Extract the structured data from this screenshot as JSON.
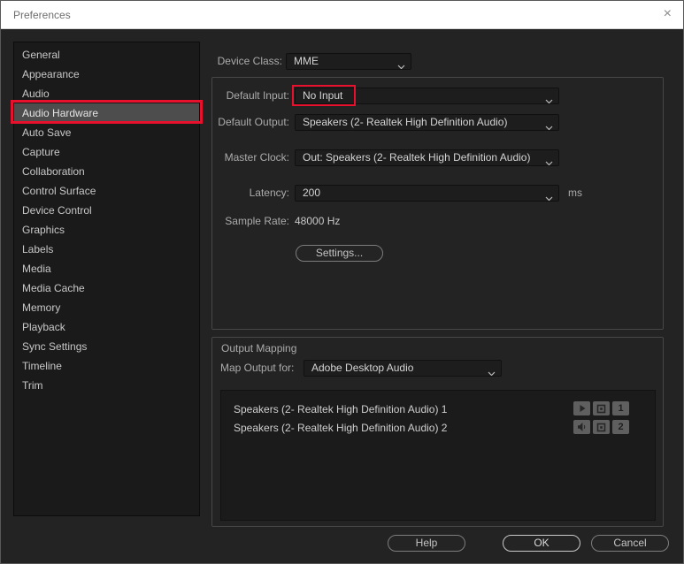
{
  "window": {
    "title": "Preferences",
    "close": "×"
  },
  "sidebar": {
    "items": [
      {
        "label": "General"
      },
      {
        "label": "Appearance"
      },
      {
        "label": "Audio"
      },
      {
        "label": "Audio Hardware",
        "selected": true
      },
      {
        "label": "Auto Save"
      },
      {
        "label": "Capture"
      },
      {
        "label": "Collaboration"
      },
      {
        "label": "Control Surface"
      },
      {
        "label": "Device Control"
      },
      {
        "label": "Graphics"
      },
      {
        "label": "Labels"
      },
      {
        "label": "Media"
      },
      {
        "label": "Media Cache"
      },
      {
        "label": "Memory"
      },
      {
        "label": "Playback"
      },
      {
        "label": "Sync Settings"
      },
      {
        "label": "Timeline"
      },
      {
        "label": "Trim"
      }
    ]
  },
  "main": {
    "device_class": {
      "label": "Device Class:",
      "value": "MME"
    },
    "default_input": {
      "label": "Default Input:",
      "value": "No Input"
    },
    "default_output": {
      "label": "Default Output:",
      "value": "Speakers (2- Realtek High Definition Audio)"
    },
    "master_clock": {
      "label": "Master Clock:",
      "value": "Out: Speakers (2- Realtek High Definition Audio)"
    },
    "latency": {
      "label": "Latency:",
      "value": "200",
      "unit": "ms"
    },
    "sample_rate": {
      "label": "Sample Rate:",
      "value": "48000 Hz"
    },
    "settings_button": "Settings...",
    "output_mapping": {
      "title": "Output Mapping",
      "map_output_for": {
        "label": "Map Output for:",
        "value": "Adobe Desktop Audio"
      },
      "rows": [
        {
          "label": "Speakers (2- Realtek High Definition Audio) 1",
          "channel": "1"
        },
        {
          "label": "Speakers (2- Realtek High Definition Audio) 2",
          "channel": "2"
        }
      ]
    }
  },
  "footer": {
    "help": "Help",
    "ok": "OK",
    "cancel": "Cancel"
  },
  "colors": {
    "annotation": "#e8112d",
    "selected_bg": "#4d4d4d"
  }
}
